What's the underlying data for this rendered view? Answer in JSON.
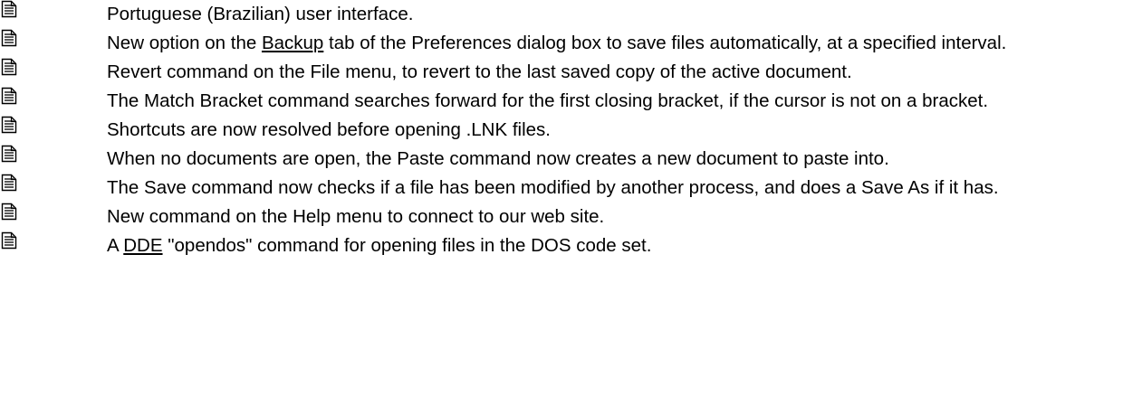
{
  "items": [
    {
      "parts": [
        {
          "text": "Portuguese (Brazilian) user interface."
        }
      ]
    },
    {
      "parts": [
        {
          "text": "New option on the "
        },
        {
          "text": "Backup",
          "link": true
        },
        {
          "text": " tab of the Preferences dialog box to save files automatically, at a specified interval."
        }
      ]
    },
    {
      "parts": [
        {
          "text": "Revert command on the File menu, to revert to the last saved copy of the active document."
        }
      ]
    },
    {
      "parts": [
        {
          "text": "The Match Bracket command searches forward for the first closing bracket, if the cursor is not on a bracket."
        }
      ]
    },
    {
      "parts": [
        {
          "text": "Shortcuts are now resolved before opening .LNK files."
        }
      ]
    },
    {
      "parts": [
        {
          "text": "When no documents are open, the Paste command now creates a new document to paste into."
        }
      ]
    },
    {
      "parts": [
        {
          "text": "The Save command now checks if a file has been modified by another process, and does a Save As if it has."
        }
      ]
    },
    {
      "parts": [
        {
          "text": "New command on the Help menu to connect to our web site."
        }
      ]
    },
    {
      "parts": [
        {
          "text": "A "
        },
        {
          "text": "DDE",
          "link": true
        },
        {
          "text": " \"opendos\" command for opening files in the DOS code set."
        }
      ]
    }
  ],
  "icon": "document-icon",
  "colors": {
    "text": "#000000",
    "icon_line": "#000000",
    "icon_border": "#000080"
  }
}
